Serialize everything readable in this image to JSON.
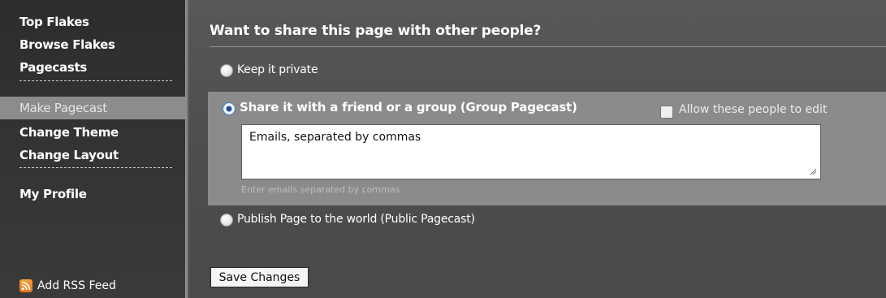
{
  "sidebar": {
    "items": [
      {
        "label": "Top Flakes"
      },
      {
        "label": "Browse Flakes"
      },
      {
        "label": "Pagecasts"
      },
      {
        "label": "Make Pagecast"
      },
      {
        "label": "Change Theme"
      },
      {
        "label": "Change Layout"
      },
      {
        "label": "My Profile"
      }
    ],
    "active_item": "Make Pagecast",
    "rss_label": "Add RSS Feed",
    "rss_icon": "rss-icon"
  },
  "main": {
    "title": "Want to share this page with other people?",
    "options": {
      "private": {
        "label": "Keep it private",
        "selected": false
      },
      "group": {
        "label": "Share it with a friend or a group (Group Pagecast)",
        "selected": true
      },
      "public": {
        "label": "Publish Page to the world (Public Pagecast)",
        "selected": false
      }
    },
    "allow_edit": {
      "label": "Allow these people to edit",
      "checked": false
    },
    "emails": {
      "value": "Emails, separated by commas",
      "hint": "Enter emails separated by commas"
    },
    "save_label": "Save Changes"
  },
  "colors": {
    "sidebar_bg": "#2d2d2d",
    "main_bg": "#555555",
    "active_item_bg": "#8c8c8c",
    "group_panel_bg": "#8b8b8b",
    "rss_orange": "#f28c28",
    "radio_selected": "#1b4f9e"
  }
}
